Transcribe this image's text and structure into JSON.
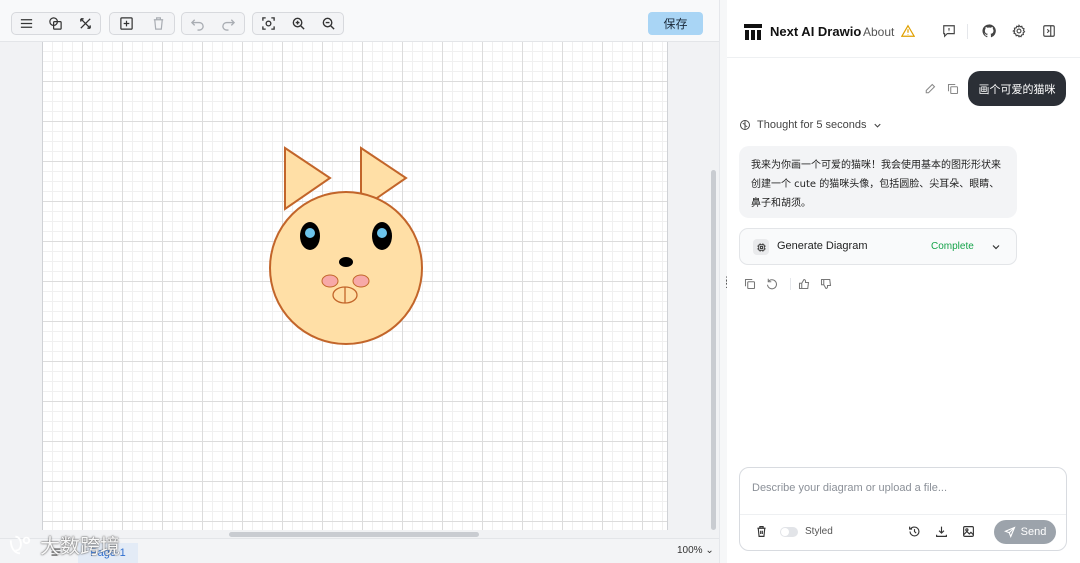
{
  "toolbar": {
    "save_label": "保存"
  },
  "canvas": {
    "page_tab": "Page-1",
    "zoom": "100%"
  },
  "panel": {
    "app_title": "Next AI Drawio",
    "about_label": "About"
  },
  "chat": {
    "user_message": "画个可爱的猫咪",
    "thought_label": "Thought for 5 seconds",
    "assistant_message": "我来为你画一个可爱的猫咪！我会使用基本的图形形状来创建一个 cute 的猫咪头像，包括圆脸、尖耳朵、眼睛、鼻子和胡须。",
    "tool_label": "Generate Diagram",
    "tool_status": "Complete"
  },
  "composer": {
    "placeholder": "Describe your diagram or upload a file...",
    "styled_label": "Styled",
    "send_label": "Send"
  },
  "watermark": {
    "text": "大数跨境"
  },
  "colors": {
    "cat_fill": "#ffdfa6",
    "cat_stroke": "#c2652a",
    "eye_highlight": "#6cc4ec",
    "cheek": "#f7a9a8",
    "save_button": "#a9d5f5",
    "status_green": "#16a34a"
  }
}
